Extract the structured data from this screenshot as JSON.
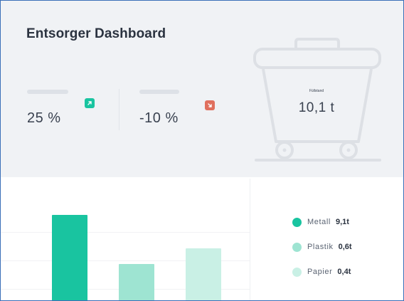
{
  "dashboard": {
    "title": "Entsorger Dashboard"
  },
  "kpis": [
    {
      "value": "25 %",
      "trend": "up",
      "trend_icon": "arrow-up-right-icon",
      "color": "#19c4a0"
    },
    {
      "value": "-10 %",
      "trend": "down",
      "trend_icon": "arrow-down-right-icon",
      "color": "#e0705e"
    }
  ],
  "fill_level": {
    "label": "Füllstand",
    "value": "10,1 t",
    "icon": "waste-container-icon"
  },
  "chart_data": {
    "type": "bar",
    "categories": [
      "Metall",
      "Plastik",
      "Papier"
    ],
    "values": [
      9.1,
      0.6,
      0.4
    ],
    "colors": [
      "#19c4a0",
      "#9ee4d2",
      "#c9f0e5"
    ],
    "grid": true
  },
  "legend": [
    {
      "name": "Metall",
      "value": "9,1t",
      "color": "#19c4a0"
    },
    {
      "name": "Plastik",
      "value": "0,6t",
      "color": "#9ee4d2"
    },
    {
      "name": "Papier",
      "value": "0,4t",
      "color": "#c9f0e5"
    }
  ]
}
